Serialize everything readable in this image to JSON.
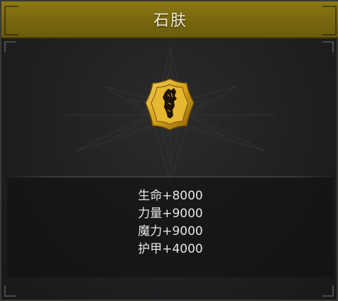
{
  "panel": {
    "title": "石肤",
    "emblem_icon": "stone-fist-icon",
    "colors": {
      "title_bar": "#7b6a0f",
      "emblem_gold": "#d4a21c",
      "background": "#1f2021",
      "stat_text": "#e6e6e6"
    }
  },
  "stats": [
    {
      "text": "生命+8000"
    },
    {
      "text": "力量+9000"
    },
    {
      "text": "魔力+9000"
    },
    {
      "text": "护甲+4000"
    }
  ]
}
